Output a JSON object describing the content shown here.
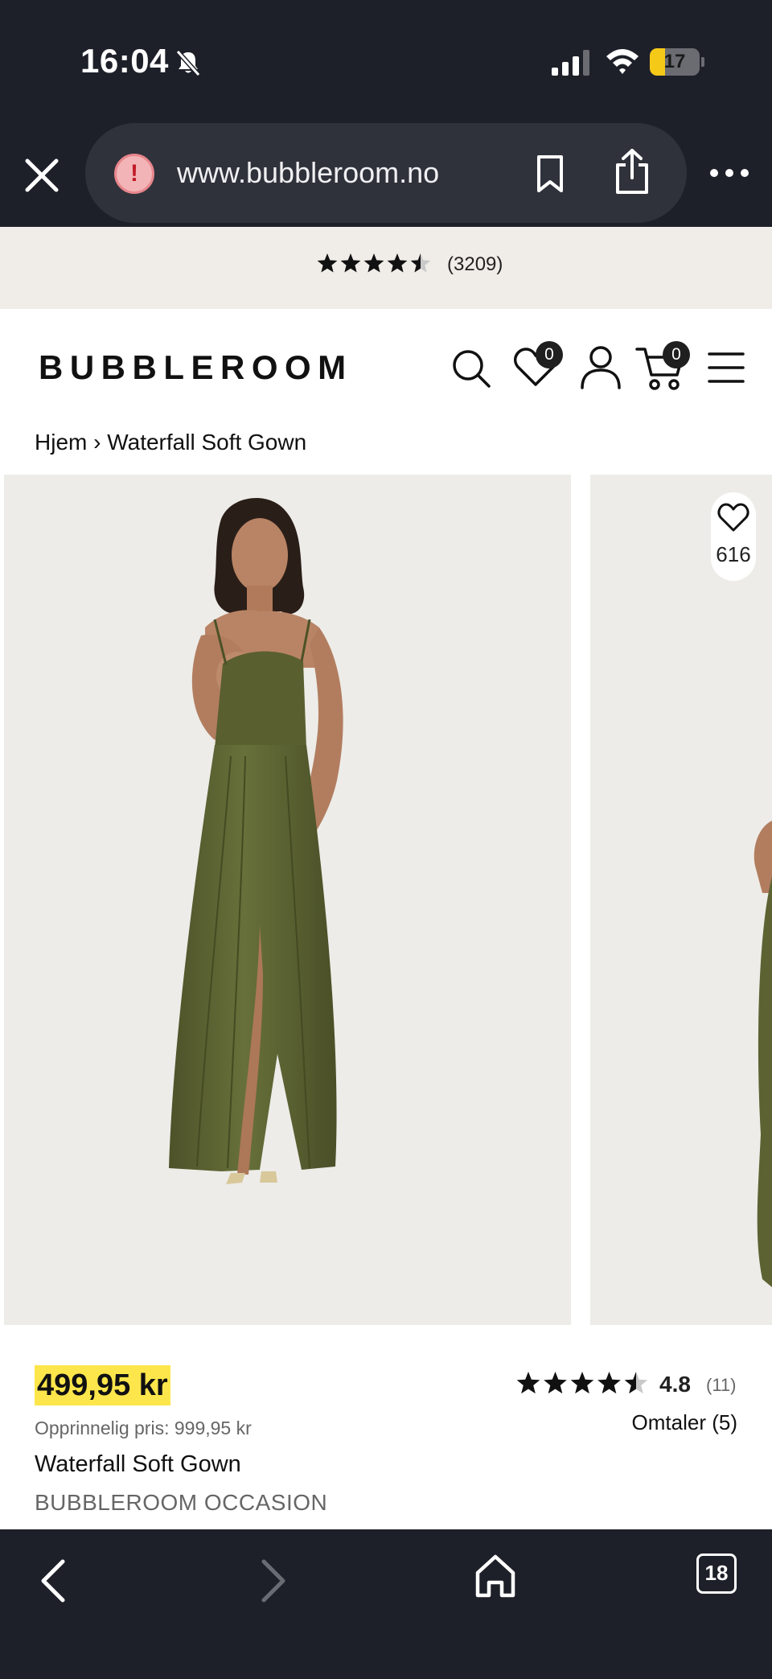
{
  "status_bar": {
    "time": "16:04",
    "battery_level": "17"
  },
  "browser": {
    "url": "www.bubbleroom.no",
    "tab_count": "18"
  },
  "site_rating": {
    "stars": 4.5,
    "count_label": "(3209)"
  },
  "header": {
    "logo": "BUBBLEROOM",
    "wishlist_count": "0",
    "cart_count": "0"
  },
  "breadcrumb": {
    "home": "Hjem",
    "separator": "›",
    "current": "Waterfall Soft Gown"
  },
  "gallery": {
    "likes": "616",
    "image_count": 5,
    "active_index": 0
  },
  "product": {
    "price": "499,95 kr",
    "original_price": "Opprinnelig pris: 999,95 kr",
    "name": "Waterfall Soft Gown",
    "brand": "BUBBLEROOM OCCASION",
    "rating_stars": 4.5,
    "rating": "4.8",
    "rating_count": "(11)",
    "reviews_link": "Omtaler (5)"
  },
  "colors": {
    "chrome_bg": "#1e2029",
    "url_pill": "#30323b",
    "battery": "#f5c917",
    "rating_strip": "#f0ede8",
    "price_highlight": "#fde64b",
    "dress": "#5d6233",
    "photo_bg": "#edece8"
  }
}
